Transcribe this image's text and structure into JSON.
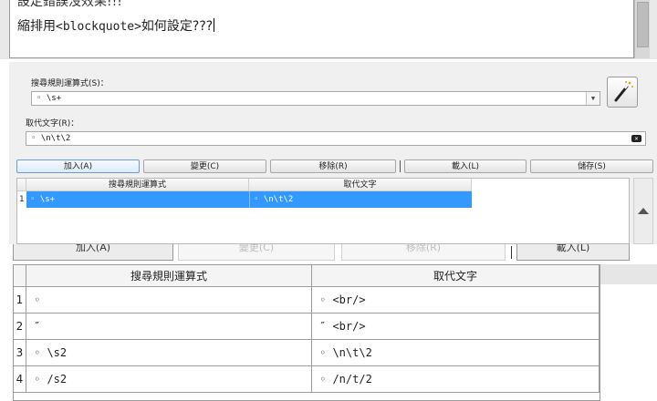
{
  "editor": {
    "line1": "設定錯誤沒效果!!!",
    "line2_prefix": "縮排用",
    "line2_code": "<blockquote>",
    "line2_suffix": "如何設定???"
  },
  "dialog": {
    "search_label": "搜尋規則運算式(S)：",
    "search_value": "◦ \\s+",
    "replace_label": "取代文字(R)：",
    "replace_value": "◦ \\n\\t\\2",
    "buttons": {
      "add": "加入(A)",
      "change": "變更(C)",
      "remove": "移除(R)",
      "load": "載入(L)",
      "save": "儲存(S)"
    },
    "table": {
      "headers": [
        "搜尋規則運算式",
        "取代文字"
      ],
      "rows": [
        {
          "num": "1",
          "search": "◦ \\s+",
          "replace": "◦ \\n\\t\\2"
        }
      ]
    }
  },
  "lower": {
    "buttons": {
      "add": "加入(A)",
      "change": "變更(C)",
      "remove": "移除(R)",
      "load": "載入(L)"
    },
    "table": {
      "headers": [
        "搜尋規則運算式",
        "取代文字"
      ],
      "rows": [
        {
          "num": "1",
          "search": "◦",
          "replace": "◦ <br/>"
        },
        {
          "num": "2",
          "search": "″",
          "replace": "″ <br/>"
        },
        {
          "num": "3",
          "search": "◦ \\s2",
          "replace": "◦ \\n\\t\\2"
        },
        {
          "num": "4",
          "search": "◦ /s2",
          "replace": "◦ /n/t/2"
        }
      ]
    }
  },
  "colors": {
    "selection": "#3399ff",
    "dialog_bg": "#f0f0f0"
  },
  "icons": [
    "magic-wand-icon",
    "dropdown-arrow-icon",
    "clear-icon",
    "scroll-up-icon"
  ]
}
